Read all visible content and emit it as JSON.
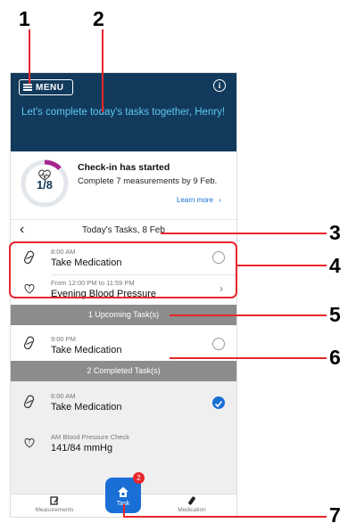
{
  "callouts": [
    "1",
    "2",
    "3",
    "4",
    "5",
    "6",
    "7"
  ],
  "header": {
    "menu_label": "MENU",
    "greeting": "Let's complete today's tasks together, Henry!"
  },
  "checkin": {
    "progress_text": "1/8",
    "progress_fraction": 0.125,
    "title": "Check-in has started",
    "description": "Complete 7 measurements by 9 Feb.",
    "learn_more": "Learn more",
    "ring_color": "#a6238f"
  },
  "date_nav": {
    "label": "Today's Tasks, 8 Feb"
  },
  "today_tasks": [
    {
      "time": "8:00 AM",
      "name": "Take Medication",
      "icon": "pill-icon",
      "action": "radio"
    },
    {
      "time": "From 12:00 PM to 11:59 PM",
      "name": "Evening Blood Pressure",
      "icon": "heart-icon",
      "action": "chevron"
    }
  ],
  "upcoming": {
    "header": "1 Upcoming Task(s)",
    "tasks": [
      {
        "time": "9:00 PM",
        "name": "Take Medication",
        "icon": "pill-icon"
      }
    ]
  },
  "completed": {
    "header": "2 Completed Task(s)",
    "tasks": [
      {
        "time": "6:00 AM",
        "name": "Take Medication",
        "icon": "pill-icon"
      },
      {
        "time": "AM Blood Pressure Check",
        "name": "141/84 mmHg",
        "icon": "heart-icon"
      }
    ]
  },
  "bottom_nav": {
    "measurements": "Measurements",
    "task": "Task",
    "task_badge": "2",
    "medication": "Medication"
  },
  "colors": {
    "header_bg": "#123a5c",
    "accent": "#1a6fd6",
    "callout_red": "#e8262b",
    "greeting": "#5ec8f2"
  }
}
